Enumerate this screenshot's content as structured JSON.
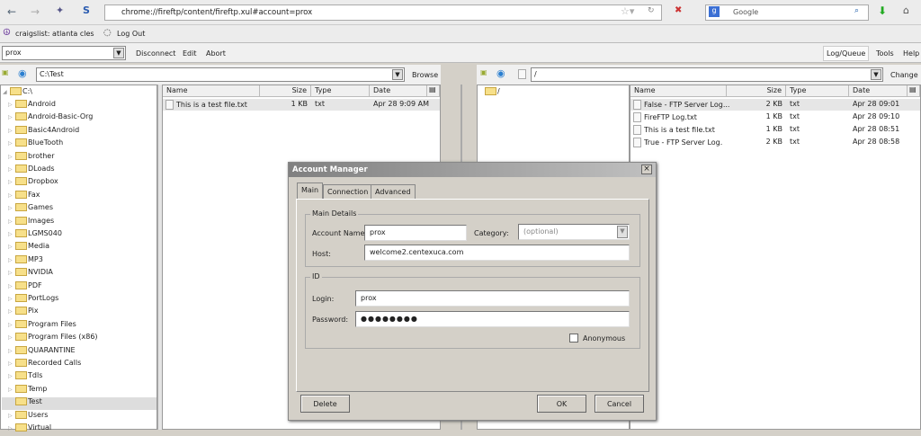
{
  "browser": {
    "url": "chrome://fireftp/content/fireftp.xul#account=prox",
    "search_placeholder": "Google",
    "bookmarks": [
      "craigslist: atlanta cles",
      "Log Out"
    ]
  },
  "ftp": {
    "account": "prox",
    "menu": [
      "Disconnect",
      "Edit",
      "Abort"
    ],
    "right_menu": [
      "Log/Queue",
      "Tools",
      "Help"
    ]
  },
  "local": {
    "path": "C:\\Test",
    "browse": "Browse",
    "root": "C:\\",
    "tree": [
      "Android",
      "Android-Basic-Org",
      "Basic4Android",
      "BlueTooth",
      "brother",
      "DLoads",
      "Dropbox",
      "Fax",
      "Games",
      "Images",
      "LGMS040",
      "Media",
      "MP3",
      "NVIDIA",
      "PDF",
      "PortLogs",
      "Pix",
      "Program Files",
      "Program Files (x86)",
      "QUARANTINE",
      "Recorded Calls",
      "Tdls",
      "Temp",
      "Test",
      "Users",
      "Virtual"
    ],
    "selected": "Test",
    "columns": [
      "Name",
      "Size",
      "Type",
      "Date"
    ],
    "files": [
      {
        "name": "This is a test file.txt",
        "size": "1 KB",
        "type": "txt",
        "date": "Apr 28 9:09 AM"
      }
    ]
  },
  "remote": {
    "path": "/",
    "change": "Change",
    "root": "/",
    "columns": [
      "Name",
      "Size",
      "Type",
      "Date"
    ],
    "files": [
      {
        "name": "False - FTP Server Log...",
        "size": "2 KB",
        "type": "txt",
        "date": "Apr 28 09:01"
      },
      {
        "name": "FireFTP Log.txt",
        "size": "1 KB",
        "type": "txt",
        "date": "Apr 28 09:10"
      },
      {
        "name": "This is a test file.txt",
        "size": "1 KB",
        "type": "txt",
        "date": "Apr 28 08:51"
      },
      {
        "name": "True - FTP Server Log.",
        "size": "2 KB",
        "type": "txt",
        "date": "Apr 28 08:58"
      }
    ]
  },
  "dialog": {
    "title": "Account Manager",
    "tabs": [
      "Main",
      "Connection",
      "Advanced"
    ],
    "main_details": "Main Details",
    "account_name_label": "Account Name:",
    "account_name": "prox",
    "category_label": "Category:",
    "category": "(optional)",
    "host_label": "Host:",
    "host": "welcome2.centexuca.com",
    "id_group": "ID",
    "login_label": "Login:",
    "login": "prox",
    "password_label": "Password:",
    "password": "●●●●●●●●",
    "anonymous": "Anonymous",
    "delete": "Delete",
    "ok": "OK",
    "cancel": "Cancel",
    "close": "×"
  }
}
